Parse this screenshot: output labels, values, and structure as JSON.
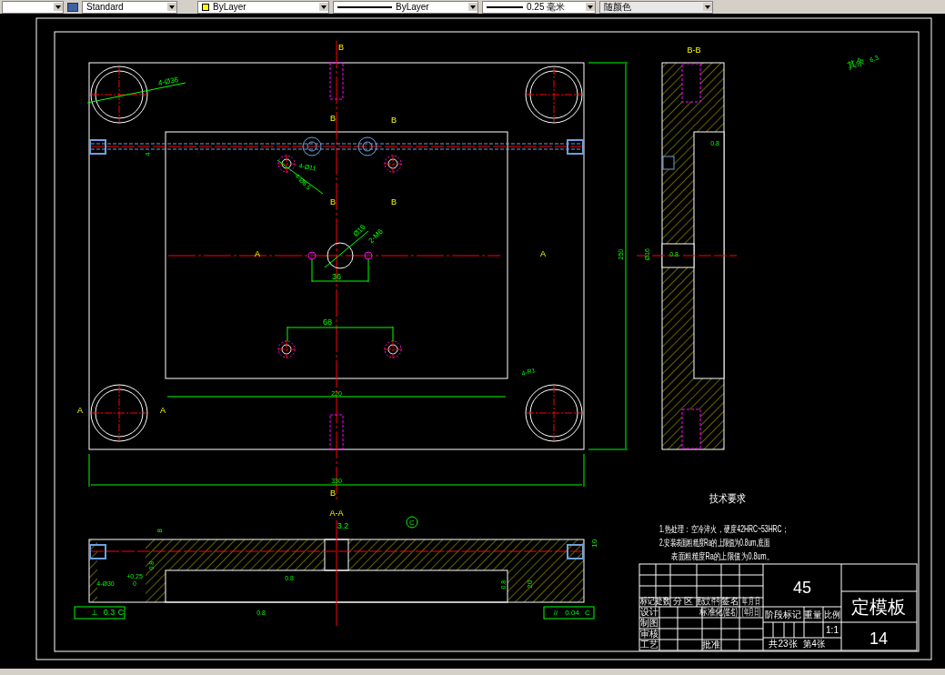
{
  "toolbar": {
    "text_style": "Standard",
    "layer": "ByLayer",
    "linetype": "ByLayer",
    "lineweight": "0.25 毫米",
    "plot_style": "随颜色"
  },
  "annotations": [
    {
      "text": "B",
      "kind": "section"
    },
    {
      "text": "B-B",
      "kind": "section"
    },
    {
      "text": "6.3",
      "kind": "dimension"
    },
    {
      "text": "其余",
      "kind": "dimension"
    },
    {
      "text": "4-Ø36",
      "kind": "dimension"
    },
    {
      "text": "B",
      "kind": "section"
    },
    {
      "text": "B",
      "kind": "section"
    },
    {
      "text": "0.8",
      "kind": "dimension"
    },
    {
      "text": "4",
      "kind": "dimension"
    },
    {
      "text": "4-Ø11",
      "kind": "dimension"
    },
    {
      "text": "4-Ø6.5",
      "kind": "dimension"
    },
    {
      "text": "B",
      "kind": "section"
    },
    {
      "text": "B",
      "kind": "section"
    },
    {
      "text": "Ø16",
      "kind": "dimension"
    },
    {
      "text": "2-M6",
      "kind": "dimension"
    },
    {
      "text": "A",
      "kind": "section"
    },
    {
      "text": "A",
      "kind": "section"
    },
    {
      "text": "250",
      "kind": "dimension"
    },
    {
      "text": "Ø16",
      "kind": "dimension"
    },
    {
      "text": "0.8",
      "kind": "dimension"
    },
    {
      "text": "36",
      "kind": "dimension"
    },
    {
      "text": "68",
      "kind": "dimension"
    },
    {
      "text": "4-R1",
      "kind": "dimension"
    },
    {
      "text": "220",
      "kind": "dimension"
    },
    {
      "text": "A",
      "kind": "section"
    },
    {
      "text": "A",
      "kind": "section"
    },
    {
      "text": "330",
      "kind": "dimension"
    },
    {
      "text": "B",
      "kind": "section"
    },
    {
      "text": "A-A",
      "kind": "section"
    },
    {
      "text": "C",
      "kind": "dimension"
    },
    {
      "text": "3.2",
      "kind": "dimension"
    },
    {
      "text": "8",
      "kind": "dimension"
    },
    {
      "text": "10",
      "kind": "dimension"
    },
    {
      "text": "0.8",
      "kind": "dimension"
    },
    {
      "text": "+0.25",
      "kind": "dimension"
    },
    {
      "text": "0.8",
      "kind": "dimension"
    },
    {
      "text": "4-Ø30",
      "kind": "dimension"
    },
    {
      "text": "0",
      "kind": "dimension"
    },
    {
      "text": "0.8",
      "kind": "dimension"
    },
    {
      "text": "20",
      "kind": "dimension"
    },
    {
      "text": "⊥",
      "kind": "dimension"
    },
    {
      "text": "0.3",
      "kind": "dimension"
    },
    {
      "text": "C",
      "kind": "dimension"
    },
    {
      "text": "0.8",
      "kind": "dimension"
    },
    {
      "text": "//",
      "kind": "dimension"
    },
    {
      "text": "0.04",
      "kind": "dimension"
    },
    {
      "text": "C",
      "kind": "dimension"
    }
  ],
  "requirements": {
    "title": "技术要求",
    "lines": [
      "1.热处理：空冷淬火，硬度42HRC~53HRC；",
      "2.安装表面粗糙度Ra的上限值为0.8um,底面",
      "表面粗糙度Ra的上限值为0.8um。"
    ]
  },
  "title_block": {
    "material": "45",
    "part_name": "定模板",
    "drawing_no": "14",
    "cells": [
      "标记",
      "处数",
      "分 区",
      "更改文件号",
      "签名",
      "年 月 日",
      "设计",
      "标准化",
      "(签名)",
      "(年月日)",
      "制图",
      "审核",
      "工艺",
      "批准",
      "阶段标记",
      "重量",
      "比例",
      "1:1",
      "共23张",
      "第4张"
    ]
  }
}
